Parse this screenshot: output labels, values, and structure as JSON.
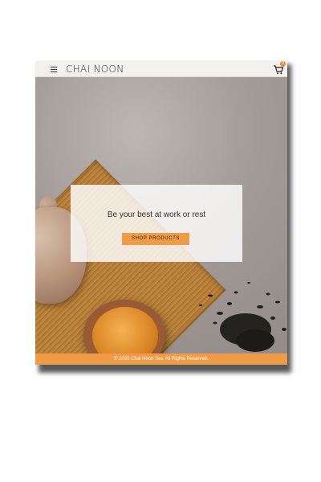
{
  "header": {
    "logo": "CHAI NOON",
    "cart_count": "0"
  },
  "hero": {
    "tagline": "Be your best at work or rest",
    "cta_label": "SHOP PRODUCTS"
  },
  "footer": {
    "copyright": "© 2020 Chai Noon Tea. All Rights Reserved."
  },
  "colors": {
    "accent": "#ef9b48",
    "header_bg": "#f3f1ee"
  },
  "icons": [
    "menu-icon",
    "cart-icon"
  ]
}
